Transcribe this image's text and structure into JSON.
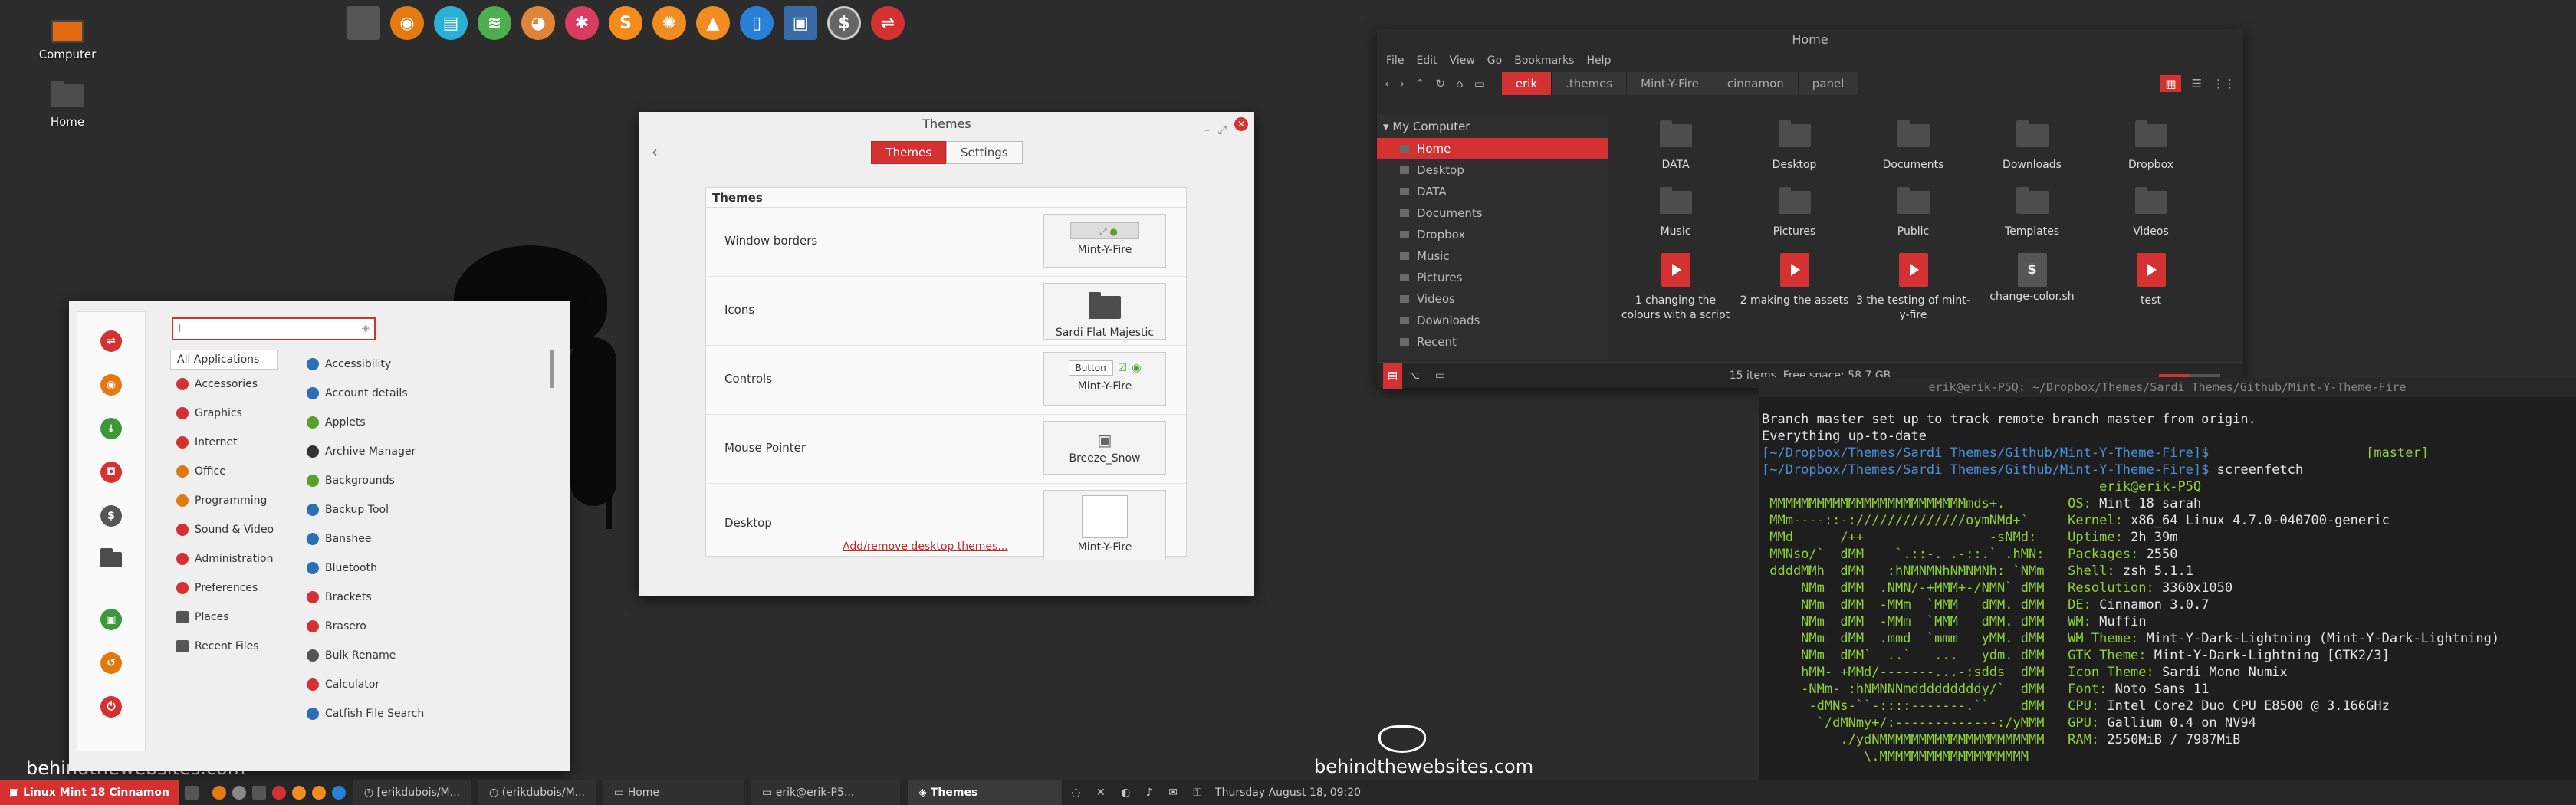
{
  "desktop": {
    "icons": [
      {
        "label": "Computer"
      },
      {
        "label": "Home"
      }
    ],
    "brand_left": "behindthewebsites.com",
    "brand_right": "behindthewebsites.com"
  },
  "themes_window": {
    "title": "Themes",
    "tabs": [
      {
        "label": "Themes",
        "active": true
      },
      {
        "label": "Settings",
        "active": false
      }
    ],
    "section": "Themes",
    "rows": [
      {
        "label": "Window borders",
        "value": "Mint-Y-Fire"
      },
      {
        "label": "Icons",
        "value": "Sardi Flat Majestic"
      },
      {
        "label": "Controls",
        "value": "Mint-Y-Fire",
        "preview": "Button"
      },
      {
        "label": "Mouse Pointer",
        "value": "Breeze_Snow"
      },
      {
        "label": "Desktop",
        "value": "Mint-Y-Fire"
      }
    ],
    "link": "Add/remove desktop themes..."
  },
  "files_window": {
    "title": "Home",
    "menu": [
      "File",
      "Edit",
      "View",
      "Go",
      "Bookmarks",
      "Help"
    ],
    "breadcrumb": [
      {
        "label": "erik",
        "active": true
      },
      {
        "label": ".themes",
        "active": false
      },
      {
        "label": "Mint-Y-Fire",
        "active": false
      },
      {
        "label": "cinnamon",
        "active": false
      },
      {
        "label": "panel",
        "active": false
      }
    ],
    "sidebar_header": "My Computer",
    "sidebar": [
      {
        "label": "Home",
        "active": true
      },
      {
        "label": "Desktop"
      },
      {
        "label": "DATA"
      },
      {
        "label": "Documents"
      },
      {
        "label": "Dropbox"
      },
      {
        "label": "Music"
      },
      {
        "label": "Pictures"
      },
      {
        "label": "Videos"
      },
      {
        "label": "Downloads"
      },
      {
        "label": "Recent"
      }
    ],
    "items": [
      {
        "label": "DATA",
        "kind": "folder"
      },
      {
        "label": "Desktop",
        "kind": "folder"
      },
      {
        "label": "Documents",
        "kind": "folder"
      },
      {
        "label": "Downloads",
        "kind": "folder"
      },
      {
        "label": "Dropbox",
        "kind": "folder"
      },
      {
        "label": "Music",
        "kind": "folder"
      },
      {
        "label": "Pictures",
        "kind": "folder"
      },
      {
        "label": "Public",
        "kind": "folder"
      },
      {
        "label": "Templates",
        "kind": "folder"
      },
      {
        "label": "Videos",
        "kind": "folder"
      },
      {
        "label": "1 changing the colours with a script",
        "kind": "video"
      },
      {
        "label": "2 making the assets",
        "kind": "video"
      },
      {
        "label": "3 the testing of mint-y-fire",
        "kind": "video"
      },
      {
        "label": "change-color.sh",
        "kind": "script"
      },
      {
        "label": "test",
        "kind": "video"
      }
    ],
    "status": "15 items, Free space: 58,7 GB"
  },
  "terminal": {
    "title": "erik@erik-P5Q: ~/Dropbox/Themes/Sardi Themes/Github/Mint-Y-Theme-Fire",
    "lines": [
      "Branch master set up to track remote branch master from origin.",
      "Everything up-to-date"
    ],
    "prompt_path": "[~/Dropbox/Themes/Sardi Themes/Github/Mint-Y-Theme-Fire]$",
    "branch": "[master]",
    "command": "screenfetch",
    "user_host": "erik@erik-P5Q",
    "info": [
      {
        "k": "OS:",
        "v": "Mint 18 sarah"
      },
      {
        "k": "Kernel:",
        "v": "x86_64 Linux 4.7.0-040700-generic"
      },
      {
        "k": "Uptime:",
        "v": "2h 39m"
      },
      {
        "k": "Packages:",
        "v": "2550"
      },
      {
        "k": "Shell:",
        "v": "zsh 5.1.1"
      },
      {
        "k": "Resolution:",
        "v": "3360x1050"
      },
      {
        "k": "DE:",
        "v": "Cinnamon 3.0.7"
      },
      {
        "k": "WM:",
        "v": "Muffin"
      },
      {
        "k": "WM Theme:",
        "v": "Mint-Y-Dark-Lightning (Mint-Y-Dark-Lightning)"
      },
      {
        "k": "GTK Theme:",
        "v": "Mint-Y-Dark-Lightning [GTK2/3]"
      },
      {
        "k": "Icon Theme:",
        "v": "Sardi Mono Numix"
      },
      {
        "k": "Font:",
        "v": "Noto Sans 11"
      },
      {
        "k": "CPU:",
        "v": "Intel Core2 Duo CPU E8500 @ 3.166GHz"
      },
      {
        "k": "GPU:",
        "v": "Gallium 0.4 on NV94"
      },
      {
        "k": "RAM:",
        "v": "2550MiB / 7987MiB"
      }
    ]
  },
  "menu": {
    "search_value": "l",
    "categories": [
      {
        "label": "All Applications",
        "active": true,
        "color": ""
      },
      {
        "label": "Accessories",
        "color": "#d43232"
      },
      {
        "label": "Graphics",
        "color": "#d43232"
      },
      {
        "label": "Internet",
        "color": "#d43232"
      },
      {
        "label": "Office",
        "color": "#e07a10"
      },
      {
        "label": "Programming",
        "color": "#e07a10"
      },
      {
        "label": "Sound & Video",
        "color": "#d43232"
      },
      {
        "label": "Administration",
        "color": "#d43232"
      },
      {
        "label": "Preferences",
        "color": "#d43232"
      },
      {
        "label": "Places",
        "color": "folder"
      },
      {
        "label": "Recent Files",
        "color": "folder"
      }
    ],
    "apps": [
      {
        "label": "Accessibility",
        "color": "#2a6fb8"
      },
      {
        "label": "Account details",
        "color": "#2a6fb8"
      },
      {
        "label": "Applets",
        "color": "#5aa02c"
      },
      {
        "label": "Archive Manager",
        "color": "#333"
      },
      {
        "label": "Backgrounds",
        "color": "#5aa02c"
      },
      {
        "label": "Backup Tool",
        "color": "#2a6fb8"
      },
      {
        "label": "Banshee",
        "color": "#2a6fb8"
      },
      {
        "label": "Bluetooth",
        "color": "#2a6fb8"
      },
      {
        "label": "Brackets",
        "color": "#d43232"
      },
      {
        "label": "Brasero",
        "color": "#d43232"
      },
      {
        "label": "Bulk Rename",
        "color": "#555"
      },
      {
        "label": "Calculator",
        "color": "#d43232"
      },
      {
        "label": "Catfish File Search",
        "color": "#2a6fb8"
      }
    ]
  },
  "taskbar": {
    "menu_label": "Linux Mint 18 Cinnamon",
    "tasks": [
      {
        "label": "[erikdubois/M...",
        "active": false
      },
      {
        "label": "(erikdubois/M...",
        "active": false
      },
      {
        "label": "Home",
        "active": false
      },
      {
        "label": "erik@erik-P5...",
        "active": false
      },
      {
        "label": "Themes",
        "active": true
      }
    ],
    "clock": "Thursday August 18, 09:20"
  },
  "colors": {
    "accent": "#d43232",
    "terminal_green": "#8fd13a",
    "terminal_blue": "#4a8fd8"
  }
}
